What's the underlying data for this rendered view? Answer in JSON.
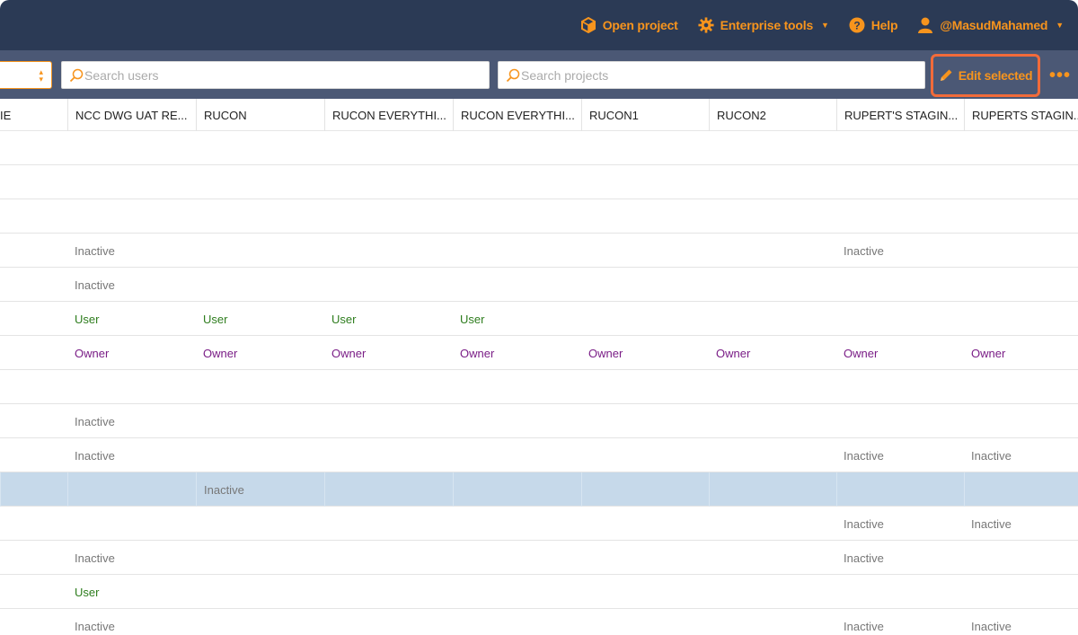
{
  "nav": {
    "open_project": "Open project",
    "enterprise_tools": "Enterprise tools",
    "help": "Help",
    "user": "@MasudMahamed",
    "accent": "#f7941d"
  },
  "toolbar": {
    "search_users_placeholder": "Search users",
    "search_projects_placeholder": "Search projects",
    "edit_selected": "Edit selected",
    "more": "•••"
  },
  "table": {
    "columns": [
      "IE",
      "NCC DWG UAT RE...",
      "RUCON",
      "RUCON EVERYTHI...",
      "RUCON EVERYTHI...",
      "RUCON1",
      "RUCON2",
      "RUPERT'S STAGIN...",
      "RUPERTS STAGIN..."
    ],
    "rows": [
      {
        "cells": [
          "",
          "",
          "",
          "",
          "",
          "",
          "",
          "",
          ""
        ]
      },
      {
        "cells": [
          "",
          "",
          "",
          "",
          "",
          "",
          "",
          "",
          ""
        ]
      },
      {
        "cells": [
          "",
          "",
          "",
          "",
          "",
          "",
          "",
          "",
          ""
        ]
      },
      {
        "cells": [
          "",
          "Inactive",
          "",
          "",
          "",
          "",
          "",
          "Inactive",
          ""
        ]
      },
      {
        "cells": [
          "",
          "Inactive",
          "",
          "",
          "",
          "",
          "",
          "",
          ""
        ]
      },
      {
        "cells": [
          "",
          "User",
          "User",
          "User",
          "User",
          "",
          "",
          "",
          ""
        ]
      },
      {
        "cells": [
          "",
          "Owner",
          "Owner",
          "Owner",
          "Owner",
          "Owner",
          "Owner",
          "Owner",
          "Owner"
        ]
      },
      {
        "cells": [
          "",
          "",
          "",
          "",
          "",
          "",
          "",
          "",
          ""
        ]
      },
      {
        "cells": [
          "",
          "Inactive",
          "",
          "",
          "",
          "",
          "",
          "",
          ""
        ]
      },
      {
        "cells": [
          "",
          "Inactive",
          "",
          "",
          "",
          "",
          "",
          "Inactive",
          "Inactive"
        ]
      },
      {
        "cells": [
          "",
          "",
          "Inactive",
          "",
          "",
          "",
          "",
          "",
          ""
        ],
        "selected": true
      },
      {
        "cells": [
          "",
          "",
          "",
          "",
          "",
          "",
          "",
          "Inactive",
          "Inactive"
        ]
      },
      {
        "cells": [
          "",
          "Inactive",
          "",
          "",
          "",
          "",
          "",
          "Inactive",
          ""
        ]
      },
      {
        "cells": [
          "",
          "User",
          "",
          "",
          "",
          "",
          "",
          "",
          ""
        ]
      },
      {
        "cells": [
          "",
          "Inactive",
          "",
          "",
          "",
          "",
          "",
          "Inactive",
          "Inactive"
        ]
      }
    ],
    "colors": {
      "inactive": "#777777",
      "user": "#2e7d1e",
      "owner": "#7a1d86",
      "selected_row": "#c6d9ea"
    }
  }
}
